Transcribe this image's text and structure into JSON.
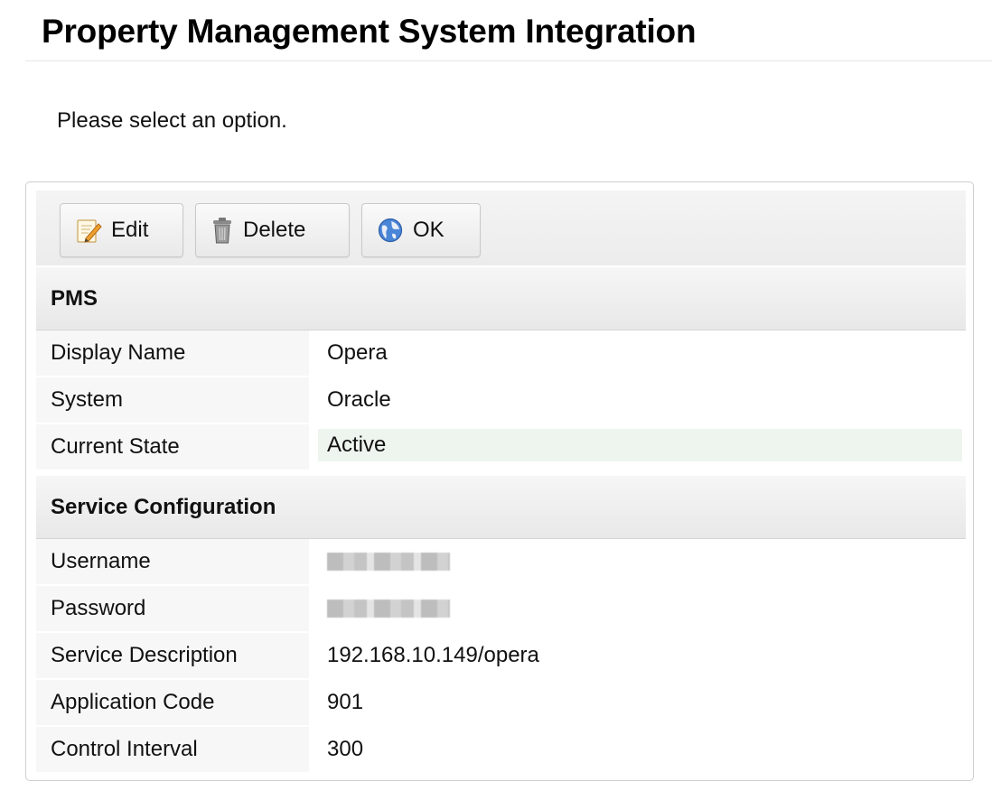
{
  "page": {
    "title": "Property Management System Integration",
    "instruction": "Please select an option."
  },
  "toolbar": {
    "edit": {
      "label": "Edit",
      "icon": "edit-icon"
    },
    "delete": {
      "label": "Delete",
      "icon": "trash-icon"
    },
    "ok": {
      "label": "OK",
      "icon": "globe-icon"
    }
  },
  "sections": {
    "pms": {
      "title": "PMS",
      "rows": [
        {
          "label": "Display Name",
          "value": "Opera"
        },
        {
          "label": "System",
          "value": "Oracle"
        },
        {
          "label": "Current State",
          "value": "Active"
        }
      ]
    },
    "service": {
      "title": "Service Configuration",
      "rows": [
        {
          "label": "Username",
          "value": ""
        },
        {
          "label": "Password",
          "value": ""
        },
        {
          "label": "Service Description",
          "value": "192.168.10.149/opera"
        },
        {
          "label": "Application Code",
          "value": "901"
        },
        {
          "label": "Control Interval",
          "value": "300"
        }
      ]
    }
  },
  "colors": {
    "active_state_bg": "#eef4ee",
    "label_bg": "#f7f7f7",
    "header_bg": "#ececec",
    "border": "#cfcfcf"
  }
}
